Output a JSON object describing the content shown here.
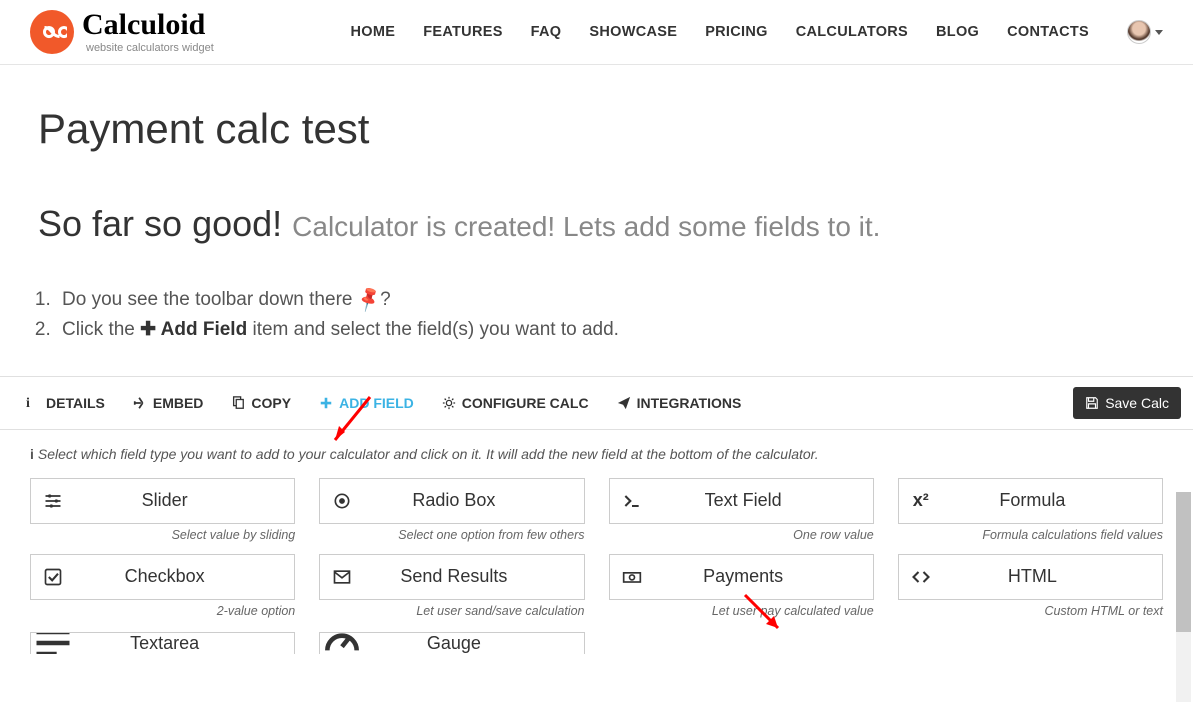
{
  "header": {
    "brand": "Calculoid",
    "tagline": "website calculators widget",
    "nav": {
      "home": "HOME",
      "features": "FEATURES",
      "faq": "FAQ",
      "showcase": "SHOWCASE",
      "pricing": "PRICING",
      "calculators": "CALCULATORS",
      "blog": "BLOG",
      "contacts": "CONTACTS"
    }
  },
  "main": {
    "title": "Payment calc test",
    "subtitle_bold": "So far so good!",
    "subtitle_light": "Calculator is created! Lets add some fields to it.",
    "step1_a": "Do you see the toolbar down there ",
    "step1_b": "?",
    "step2_a": "Click the ",
    "step2_bold": " Add Field",
    "step2_b": " item and select the field(s) you want to add."
  },
  "toolbar": {
    "details": "DETAILS",
    "embed": "EMBED",
    "copy": "COPY",
    "add_field": "ADD FIELD",
    "configure": "CONFIGURE CALC",
    "integrations": "INTEGRATIONS",
    "save": "Save Calc"
  },
  "panel": {
    "hint": "Select which field type you want to add to your calculator and click on it. It will add the new field at the bottom of the calculator.",
    "fields": {
      "slider": {
        "label": "Slider",
        "desc": "Select value by sliding"
      },
      "radio": {
        "label": "Radio Box",
        "desc": "Select one option from few others"
      },
      "text": {
        "label": "Text Field",
        "desc": "One row value"
      },
      "formula": {
        "label": "Formula",
        "desc": "Formula calculations field values"
      },
      "checkbox": {
        "label": "Checkbox",
        "desc": "2-value option"
      },
      "send": {
        "label": "Send Results",
        "desc": "Let user sand/save calculation"
      },
      "payments": {
        "label": "Payments",
        "desc": "Let user pay calculated value"
      },
      "html": {
        "label": "HTML",
        "desc": "Custom HTML or text"
      },
      "textarea": {
        "label": "Textarea"
      },
      "gauge": {
        "label": "Gauge"
      }
    }
  }
}
